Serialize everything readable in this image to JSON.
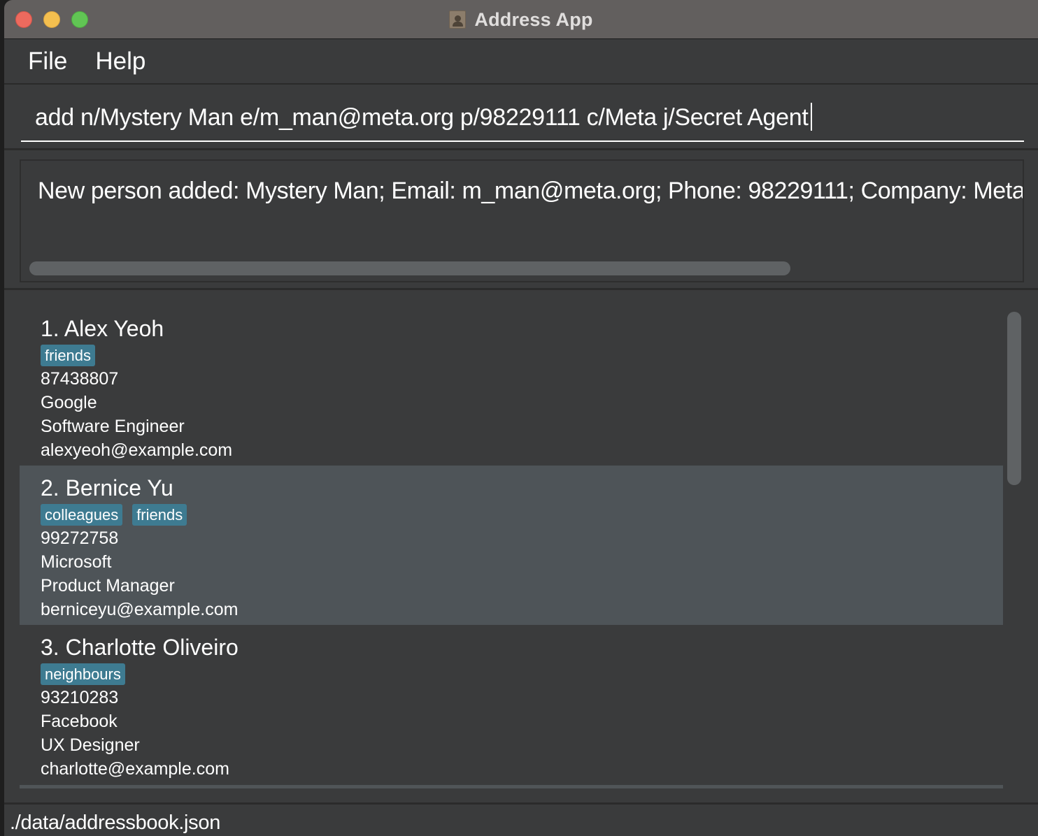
{
  "window": {
    "title": "Address App"
  },
  "menu": {
    "items": [
      "File",
      "Help"
    ]
  },
  "command": {
    "value": "add n/Mystery Man e/m_man@meta.org p/98229111 c/Meta j/Secret Agent"
  },
  "result": {
    "text": "New person added: Mystery Man; Email: m_man@meta.org; Phone: 98229111; Company: Meta; Position: Secret Agent"
  },
  "persons": [
    {
      "name": "1. Alex Yeoh",
      "tags": [
        "friends"
      ],
      "phone": "87438807",
      "company": "Google",
      "position": "Software Engineer",
      "email": "alexyeoh@example.com",
      "selected": false
    },
    {
      "name": "2. Bernice Yu",
      "tags": [
        "colleagues",
        "friends"
      ],
      "phone": "99272758",
      "company": "Microsoft",
      "position": "Product Manager",
      "email": "berniceyu@example.com",
      "selected": true
    },
    {
      "name": "3. Charlotte Oliveiro",
      "tags": [
        "neighbours"
      ],
      "phone": "93210283",
      "company": "Facebook",
      "position": "UX Designer",
      "email": "charlotte@example.com",
      "selected": false
    }
  ],
  "status": {
    "path": "./data/addressbook.json"
  },
  "colors": {
    "tag_bg": "#3e7b91",
    "selected_row": "#4e5458",
    "panel_bg": "#3a3b3c",
    "titlebar_bg": "#625f5e"
  }
}
